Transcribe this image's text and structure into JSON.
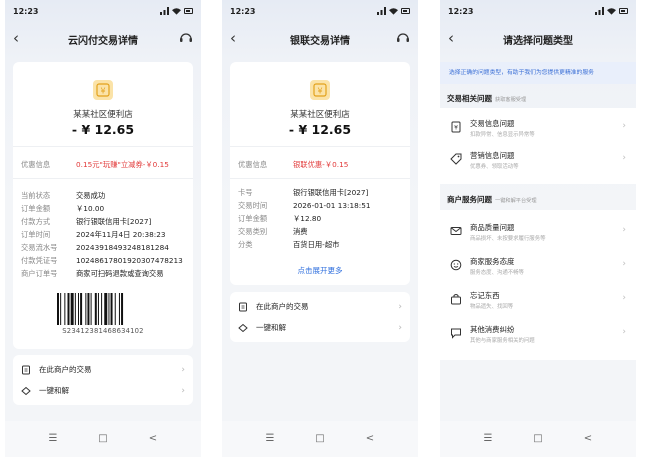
{
  "status_time": "12:23",
  "screens": [
    {
      "title": "云闪付交易详情",
      "merchant": "某某社区便利店",
      "amount": "- ¥ 12.65",
      "discount_label": "优惠信息",
      "discount_value": "0.15元\"玩赚\"立减券-￥0.15",
      "rows": [
        {
          "k": "当前状态",
          "v": "交易成功"
        },
        {
          "k": "订单金额",
          "v": "￥10.00"
        },
        {
          "k": "付款方式",
          "v": "银行银联信用卡[2027]"
        },
        {
          "k": "订单时间",
          "v": "2024年11月4日 20:38:23"
        },
        {
          "k": "交易流水号",
          "v": "20243918493248181284"
        },
        {
          "k": "付款凭证号",
          "v": "10248617801920307478213"
        },
        {
          "k": "商户订单号",
          "v": "商家可扫码退款或查询交易"
        }
      ],
      "barcode_number": "S2341238146863410​2",
      "actions": [
        {
          "label": "在此商户的交易"
        },
        {
          "label": "一键和解"
        }
      ]
    },
    {
      "title": "银联交易详情",
      "merchant": "某某社区便利店",
      "amount": "- ¥ 12.65",
      "discount_label": "优惠信息",
      "discount_value": "银联优惠-￥0.15",
      "rows": [
        {
          "k": "卡号",
          "v": "银行银联信用卡[2027]"
        },
        {
          "k": "交易时间",
          "v": "2026-01-01 13:18:51"
        },
        {
          "k": "订单金额",
          "v": "￥12.80"
        },
        {
          "k": "交易类别",
          "v": "消费"
        },
        {
          "k": "分类",
          "v": "百货日用-超市"
        }
      ],
      "expand_label": "点击展开更多",
      "actions": [
        {
          "label": "在此商户的交易"
        },
        {
          "label": "一键和解"
        }
      ]
    },
    {
      "title": "请选择问题类型",
      "hint": "选择正确的问题类型，有助于我们为您提供更精准的服务",
      "section1": {
        "title": "交易相关问题",
        "sub": "获取客服受理"
      },
      "section1_items": [
        {
          "title": "交易信息问题",
          "sub": "扣款异常、信息显示异常等"
        },
        {
          "title": "营销信息问题",
          "sub": "优惠券、领取活动等"
        }
      ],
      "section2": {
        "title": "商户服务问题",
        "sub": "一键和解平台受理"
      },
      "section2_items": [
        {
          "title": "商品质量问题",
          "sub": "商品损坏、未按要求履行服务等"
        },
        {
          "title": "商家服务态度",
          "sub": "服务态度、沟通不畅等"
        },
        {
          "title": "忘记东西",
          "sub": "物品遗失、找回等"
        },
        {
          "title": "其他消费纠纷",
          "sub": "其他与商家服务相关的问题"
        }
      ]
    }
  ],
  "nav": {
    "menu": "☰",
    "home": "□",
    "back": "<"
  },
  "colors": {
    "discount_red": "#e23b3b",
    "link_blue": "#2f6fde",
    "hint_bg": "#e9effb"
  }
}
